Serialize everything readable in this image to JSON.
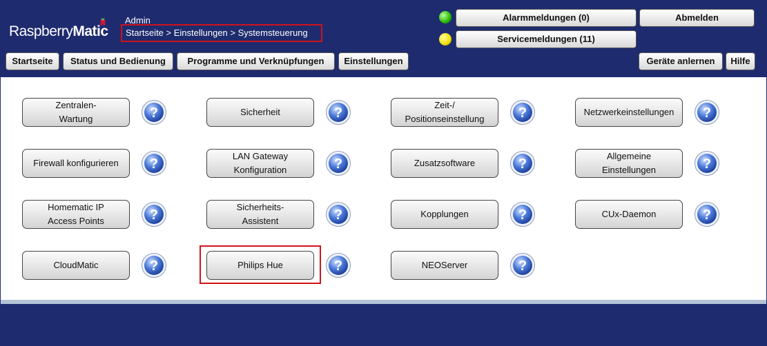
{
  "app": {
    "logo_light": "Raspberry",
    "logo_bold": "Matic",
    "user": "Admin"
  },
  "breadcrumb": "Startseite > Einstellungen > Systemsteuerung",
  "status": {
    "alarm_label": "Alarmmeldungen (0)",
    "service_label": "Servicemeldungen (11)",
    "alarm_led_color": "#27b800",
    "service_led_color": "#f0e000"
  },
  "header": {
    "logout": "Abmelden",
    "teach_in": "Geräte anlernen",
    "help": "Hilfe"
  },
  "nav": [
    "Startseite",
    "Status und Bedienung",
    "Programme und Verknüpfungen",
    "Einstellungen"
  ],
  "tiles": [
    "Zentralen-\nWartung",
    "Sicherheit",
    "Zeit-/\nPositionseinstellung",
    "Netzwerkeinstellungen",
    "Firewall konfigurieren",
    "LAN Gateway\nKonfiguration",
    "Zusatzsoftware",
    "Allgemeine\nEinstellungen",
    "Homematic IP\nAccess Points",
    "Sicherheits-\nAssistent",
    "Kopplungen",
    "CUx-Daemon",
    "CloudMatic",
    "Philips Hue",
    "NEOServer"
  ],
  "icons": {
    "help": "help-question-icon",
    "logo": "raspberry-icon"
  },
  "colors": {
    "header_bg": "#1e2b6e",
    "highlight": "#d0121b"
  }
}
